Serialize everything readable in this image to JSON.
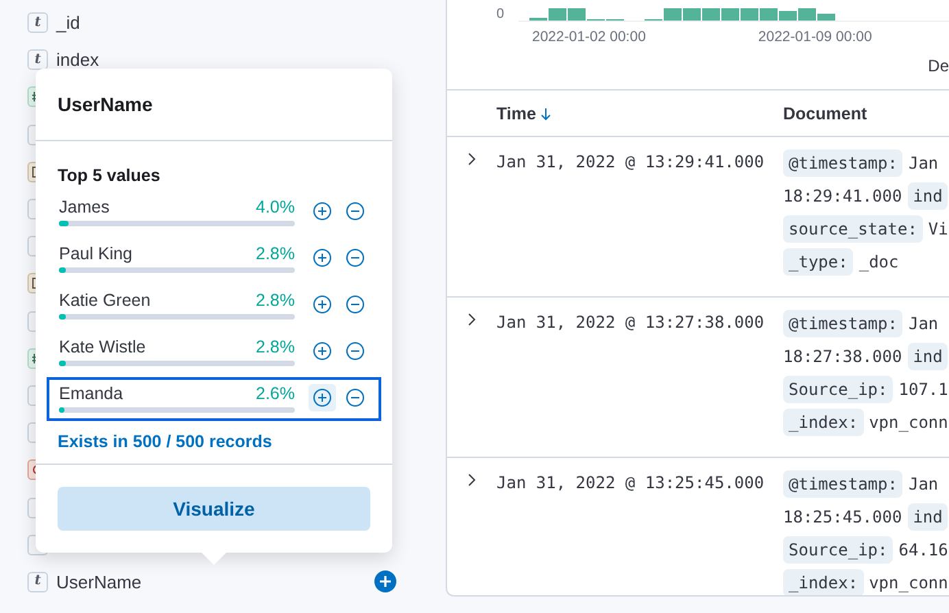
{
  "sidebar": {
    "fields": [
      {
        "name": "_id",
        "kind": "string",
        "glyph": "t"
      },
      {
        "name": "index",
        "kind": "string",
        "glyph": "t"
      },
      {
        "kind": "number"
      },
      {
        "kind": "string"
      },
      {
        "kind": "date"
      },
      {
        "kind": "string"
      },
      {
        "kind": "string"
      },
      {
        "kind": "date"
      },
      {
        "kind": "string"
      },
      {
        "kind": "number"
      },
      {
        "kind": "string"
      },
      {
        "kind": "string"
      },
      {
        "kind": "ip"
      },
      {
        "kind": "string"
      },
      {
        "kind": "string"
      },
      {
        "name": "UserName",
        "kind": "string",
        "glyph": "t"
      }
    ]
  },
  "popover": {
    "title": "UserName",
    "subtitle": "Top 5 values",
    "values": [
      {
        "label": "James",
        "percent": "4.0%",
        "level": 0.04,
        "selected": false
      },
      {
        "label": "Paul King",
        "percent": "2.8%",
        "level": 0.028,
        "selected": false
      },
      {
        "label": "Katie Green",
        "percent": "2.8%",
        "level": 0.028,
        "selected": false
      },
      {
        "label": "Kate Wistle",
        "percent": "2.8%",
        "level": 0.028,
        "selected": false
      },
      {
        "label": "Emanda",
        "percent": "2.6%",
        "level": 0.026,
        "selected": true
      }
    ],
    "exists": "Exists in 500 / 500 records",
    "button": "Visualize"
  },
  "chart": {
    "y_tick": "0",
    "x_ticks": [
      "2022-01-02 00:00",
      "2022-01-09 00:00"
    ],
    "x_label": "De"
  },
  "table": {
    "columns": [
      {
        "label": "Time",
        "sorted_descending": true
      },
      {
        "label": "Document"
      }
    ],
    "rows": [
      {
        "time": "Jan 31, 2022 @ 13:29:41.000",
        "lines": [
          [
            {
              "kind": "key",
              "text": "@timestamp:"
            },
            {
              "kind": "value",
              "text": "Jan"
            }
          ],
          [
            {
              "kind": "value",
              "text": "18:29:41.000"
            },
            {
              "kind": "key",
              "text": "ind"
            }
          ],
          [
            {
              "kind": "key",
              "text": "source_state:"
            },
            {
              "kind": "value",
              "text": "Vi"
            }
          ],
          [
            {
              "kind": "key",
              "text": "_type:"
            },
            {
              "kind": "value",
              "text": "_doc"
            }
          ]
        ]
      },
      {
        "time": "Jan 31, 2022 @ 13:27:38.000",
        "lines": [
          [
            {
              "kind": "key",
              "text": "@timestamp:"
            },
            {
              "kind": "value",
              "text": "Jan"
            }
          ],
          [
            {
              "kind": "value",
              "text": "18:27:38.000"
            },
            {
              "kind": "key",
              "text": "ind"
            }
          ],
          [
            {
              "kind": "key",
              "text": "Source_ip:"
            },
            {
              "kind": "value",
              "text": "107.1"
            }
          ],
          [
            {
              "kind": "key",
              "text": "_index:"
            },
            {
              "kind": "value",
              "text": "vpn_conn"
            }
          ]
        ]
      },
      {
        "time": "Jan 31, 2022 @ 13:25:45.000",
        "lines": [
          [
            {
              "kind": "key",
              "text": "@timestamp:"
            },
            {
              "kind": "value",
              "text": "Jan"
            }
          ],
          [
            {
              "kind": "value",
              "text": "18:25:45.000"
            },
            {
              "kind": "key",
              "text": "ind"
            }
          ],
          [
            {
              "kind": "key",
              "text": "Source_ip:"
            },
            {
              "kind": "value",
              "text": "64.16"
            }
          ],
          [
            {
              "kind": "key",
              "text": "_index:"
            },
            {
              "kind": "value",
              "text": "vpn_conn"
            }
          ]
        ]
      }
    ]
  }
}
